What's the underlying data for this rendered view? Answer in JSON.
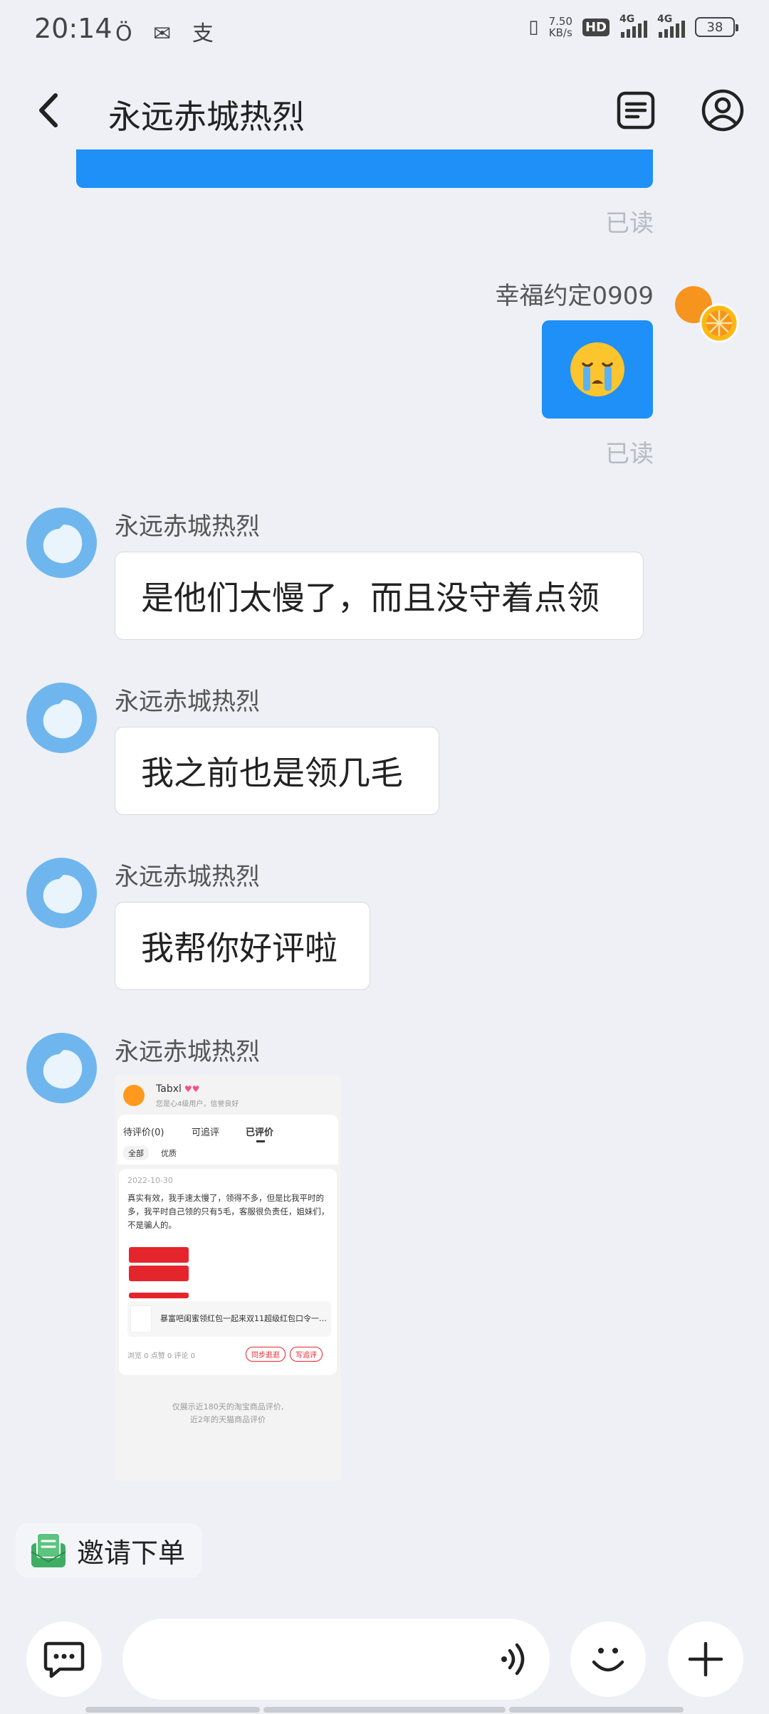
{
  "status_bar": {
    "time": "20:14",
    "left_icons": [
      "alarm-icon",
      "wechat-icon",
      "alipay-icon"
    ],
    "net_speed_value": "7.50",
    "net_speed_unit": "KB/s",
    "hd_label": "HD",
    "sim1_label": "4G",
    "sim2_label": "4G",
    "battery": "38"
  },
  "header": {
    "title": "永远赤城热烈"
  },
  "messages": {
    "read_label": "已读",
    "me_name": "幸福约定0909",
    "other_name": "永远赤城热烈",
    "texts": [
      "是他们太慢了，而且没守着点领",
      "我之前也是领几毛",
      "我帮你好评啦"
    ]
  },
  "screenshot": {
    "username": "Tabxl",
    "user_sub": "您是心4级用户，信誉良好",
    "tabs": [
      "待评价(0)",
      "可追评",
      "已评价"
    ],
    "chips": [
      "全部",
      "优质"
    ],
    "date": "2022-10-30",
    "review": "真实有效，我手速太慢了，领得不多，但是比我平时的多，我平时自己领的只有5毛，客服很负责任，姐妹们，不是骗人的。",
    "product": "暴富吧闺蜜领红包一起来双11超级红包口令一…",
    "stats": "浏览 0   点赞 0   评论 0",
    "btn_sync": "同步逛逛",
    "btn_followup": "写追评",
    "footer_line1": "仅展示近180天的淘宝商品评价,",
    "footer_line2": "近2年的天猫商品评价"
  },
  "invite": {
    "label": "邀请下单"
  },
  "colors": {
    "accent_blue": "#1e90f7",
    "avatar_blue": "#6fb6ee",
    "background": "#eef0f5"
  }
}
